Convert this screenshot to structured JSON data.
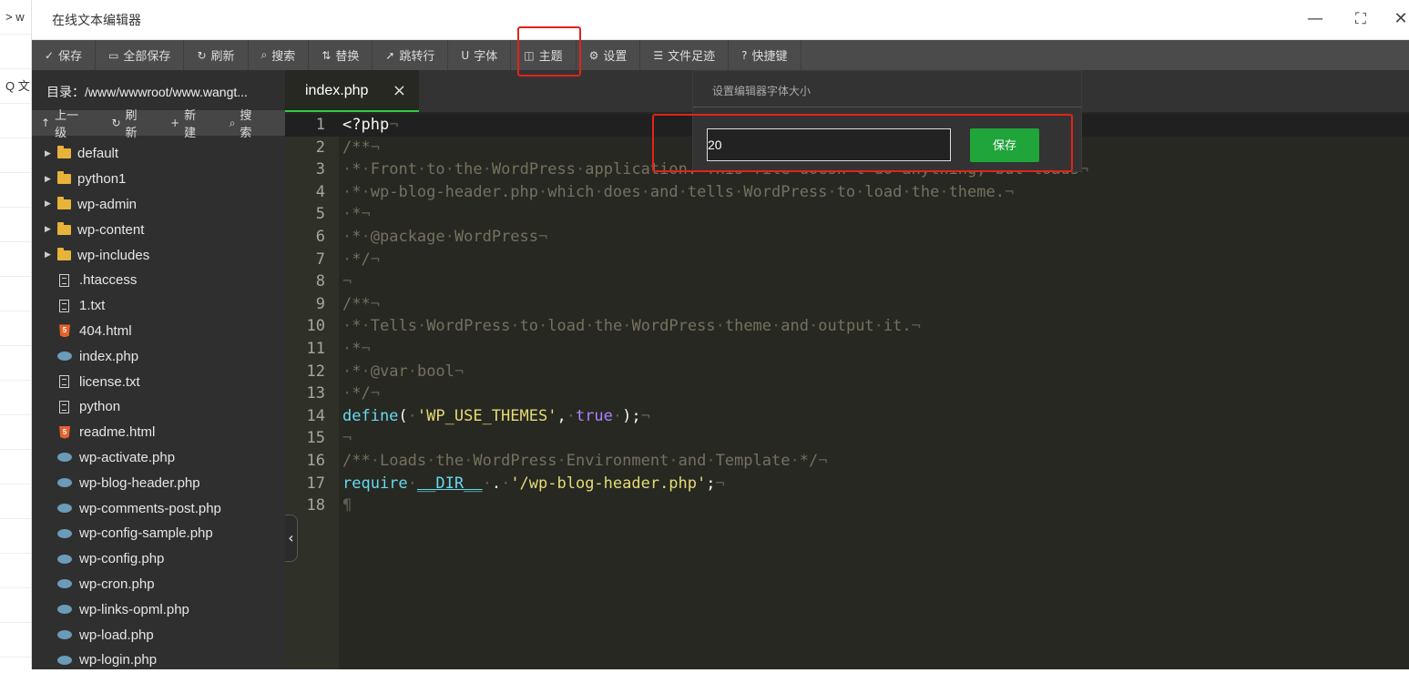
{
  "bg_page": {
    "rows": [
      ">  w",
      "",
      "Q 文",
      "",
      "",
      "",
      "",
      "",
      "",
      "",
      "",
      "",
      "",
      "",
      "",
      "",
      "",
      "",
      ""
    ]
  },
  "window": {
    "title": "在线文本编辑器",
    "minimize_glyph": "—",
    "maximize_glyph": "⛶",
    "close_glyph": "✕"
  },
  "toolbar": {
    "items": [
      {
        "icon": "✓",
        "label": "保存"
      },
      {
        "icon": "▭",
        "label": "全部保存"
      },
      {
        "icon": "↻",
        "label": "刷新"
      },
      {
        "icon": "⌕",
        "label": "搜索"
      },
      {
        "icon": "⇅",
        "label": "替换"
      },
      {
        "icon": "➚",
        "label": "跳转行"
      },
      {
        "icon": "U",
        "label": "字体"
      },
      {
        "icon": "◫",
        "label": "主题"
      },
      {
        "icon": "⚙",
        "label": "设置"
      },
      {
        "icon": "☰",
        "label": "文件足迹"
      },
      {
        "icon": "?",
        "label": "快捷键"
      }
    ]
  },
  "sidebar": {
    "path": "目录：/www/wwwroot/www.wangt...",
    "actions": [
      {
        "icon": "↑",
        "label": "上一级"
      },
      {
        "icon": "↻",
        "label": "刷新"
      },
      {
        "icon": "+",
        "label": "新建"
      },
      {
        "icon": "⌕",
        "label": "搜索"
      }
    ],
    "tree": [
      {
        "type": "folder",
        "name": "default"
      },
      {
        "type": "folder",
        "name": "python1"
      },
      {
        "type": "folder",
        "name": "wp-admin"
      },
      {
        "type": "folder",
        "name": "wp-content"
      },
      {
        "type": "folder",
        "name": "wp-includes"
      },
      {
        "type": "file",
        "name": ".htaccess"
      },
      {
        "type": "file",
        "name": "1.txt"
      },
      {
        "type": "html",
        "name": "404.html"
      },
      {
        "type": "php",
        "name": "index.php"
      },
      {
        "type": "file",
        "name": "license.txt"
      },
      {
        "type": "file",
        "name": "python"
      },
      {
        "type": "html",
        "name": "readme.html"
      },
      {
        "type": "php",
        "name": "wp-activate.php"
      },
      {
        "type": "php",
        "name": "wp-blog-header.php"
      },
      {
        "type": "php",
        "name": "wp-comments-post.php"
      },
      {
        "type": "php",
        "name": "wp-config-sample.php"
      },
      {
        "type": "php",
        "name": "wp-config.php"
      },
      {
        "type": "php",
        "name": "wp-cron.php"
      },
      {
        "type": "php",
        "name": "wp-links-opml.php"
      },
      {
        "type": "php",
        "name": "wp-load.php"
      },
      {
        "type": "php",
        "name": "wp-login.php"
      }
    ],
    "collapse_glyph": "‹"
  },
  "editor": {
    "tab": {
      "label": "index.php",
      "close": "×"
    },
    "line_numbers": [
      "1",
      "2",
      "3",
      "4",
      "5",
      "6",
      "7",
      "8",
      "9",
      "10",
      "11",
      "12",
      "13",
      "14",
      "15",
      "16",
      "17",
      "18"
    ]
  },
  "font_popup": {
    "title": "设置编辑器字体大小",
    "value": "20",
    "save_label": "保存"
  },
  "colors": {
    "toolbar_bg": "#4b4b4b",
    "editor_bg": "#272822",
    "accent_green": "#20a53a",
    "highlight_red": "#e2231a"
  }
}
